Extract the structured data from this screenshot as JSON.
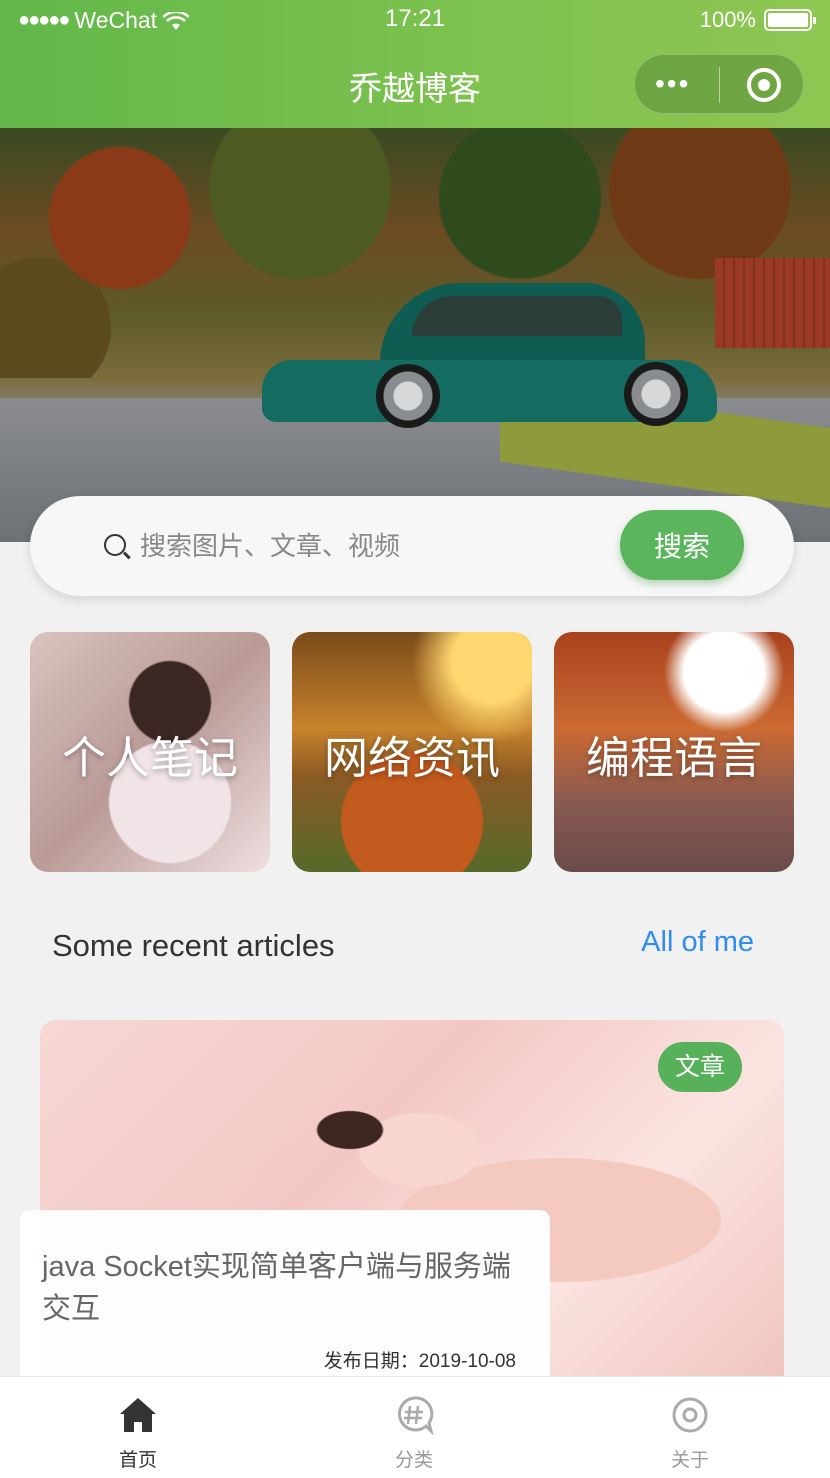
{
  "status_bar": {
    "carrier": "WeChat",
    "time": "17:21",
    "battery": "100%"
  },
  "nav": {
    "title": "乔越博客",
    "capsule_more": "•••"
  },
  "search": {
    "placeholder": "搜索图片、文章、视频",
    "button_label": "搜索"
  },
  "categories": [
    {
      "label": "个人笔记"
    },
    {
      "label": "网络资讯"
    },
    {
      "label": "编程语言"
    }
  ],
  "section": {
    "title": "Some recent articles",
    "link": "All of me"
  },
  "article": {
    "tag": "文章",
    "title": "java Socket实现简单客户端与服务端交互",
    "date": "发布日期：2019-10-08"
  },
  "tabbar": {
    "items": [
      {
        "label": "首页",
        "icon": "home-icon",
        "active": true
      },
      {
        "label": "分类",
        "icon": "hash-chat-icon",
        "active": false
      },
      {
        "label": "关于",
        "icon": "target-icon",
        "active": false
      }
    ]
  },
  "colors": {
    "header_green": "#6cbc4c",
    "accent_green": "#5ab55d",
    "link_blue": "#2f8cf0"
  }
}
